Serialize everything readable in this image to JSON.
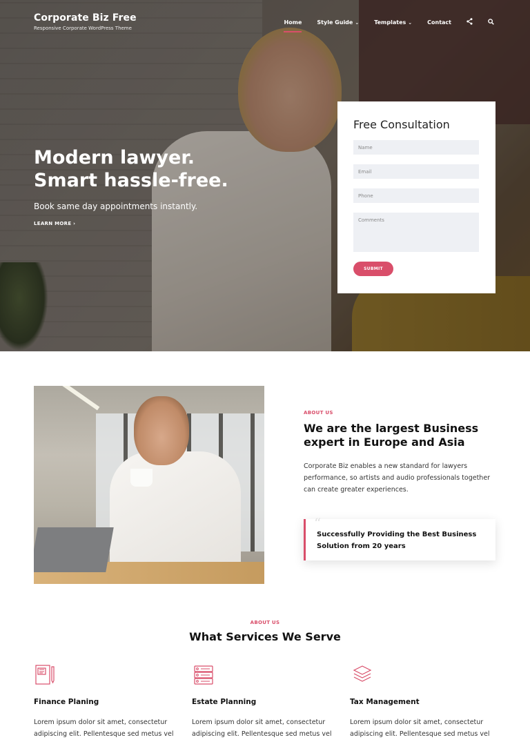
{
  "site": {
    "name": "Corporate Biz Free",
    "tagline": "Responsive Corporate WordPress Theme"
  },
  "nav": {
    "items": [
      {
        "label": "Home",
        "active": true,
        "dropdown": false
      },
      {
        "label": "Style Guide",
        "active": false,
        "dropdown": true
      },
      {
        "label": "Templates",
        "active": false,
        "dropdown": true
      },
      {
        "label": "Contact",
        "active": false,
        "dropdown": false
      }
    ],
    "icons": [
      "share-icon",
      "search-icon"
    ]
  },
  "hero": {
    "title_line1": "Modern lawyer.",
    "title_line2": "Smart hassle-free.",
    "subtitle": "Book same day appointments instantly.",
    "cta": "LEARN MORE ›"
  },
  "consultation": {
    "title": "Free Consultation",
    "fields": {
      "name": "Name",
      "email": "Email",
      "phone": "Phone",
      "comments": "Comments"
    },
    "submit": "SUBMIT"
  },
  "about": {
    "eyebrow": "ABOUT US",
    "title": "We are the largest Business expert in Europe and Asia",
    "body": "Corporate Biz enables a new standard for lawyers performance, so artists and audio professionals together can create greater experiences.",
    "quote_mark": "“",
    "quote": "Successfully Providing the Best Business Solution from 20 years"
  },
  "services": {
    "eyebrow": "ABOUT US",
    "title": "What Services We Serve",
    "items": [
      {
        "title": "Finance Planing",
        "icon": "notebook-icon",
        "body": "Lorem ipsum dolor sit amet, consectetur adipiscing elit. Pellentesque sed metus vel"
      },
      {
        "title": "Estate Planning",
        "icon": "server-icon",
        "body": "Lorem ipsum dolor sit amet, consectetur adipiscing elit. Pellentesque sed metus vel"
      },
      {
        "title": "Tax Management",
        "icon": "layers-icon",
        "body": "Lorem ipsum dolor sit amet, consectetur adipiscing elit. Pellentesque sed metus vel"
      }
    ]
  },
  "colors": {
    "accent": "#d94e6a",
    "field_bg": "#eef0f4",
    "heading": "#111111"
  }
}
